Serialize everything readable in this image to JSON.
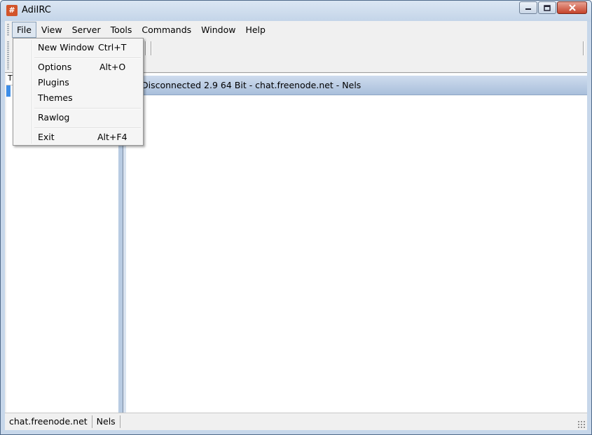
{
  "window": {
    "title": "AdiIRC",
    "app_icon_glyph": "#",
    "accent": "#d2542a"
  },
  "menubar": {
    "items": [
      "File",
      "View",
      "Server",
      "Tools",
      "Commands",
      "Window",
      "Help"
    ]
  },
  "file_menu": {
    "items": [
      {
        "label": "New Window",
        "shortcut": "Ctrl+T"
      },
      {
        "label": "Options",
        "shortcut": "Alt+O"
      },
      {
        "label": "Plugins",
        "shortcut": ""
      },
      {
        "label": "Themes",
        "shortcut": ""
      },
      {
        "label": "Rawlog",
        "shortcut": ""
      },
      {
        "label": "Exit",
        "shortcut": "Alt+F4"
      }
    ]
  },
  "tree": {
    "header": "T"
  },
  "chat": {
    "topic": "Disconnected 2.9 64 Bit - chat.freenode.net - Nels"
  },
  "statusbar": {
    "server": "chat.freenode.net",
    "nick": "Nels"
  },
  "colors": {
    "titlebar": "#c7d7ea",
    "topic_bar": "#b8cbe2",
    "selection": "#3d8ee8",
    "close_button": "#c5422a"
  }
}
